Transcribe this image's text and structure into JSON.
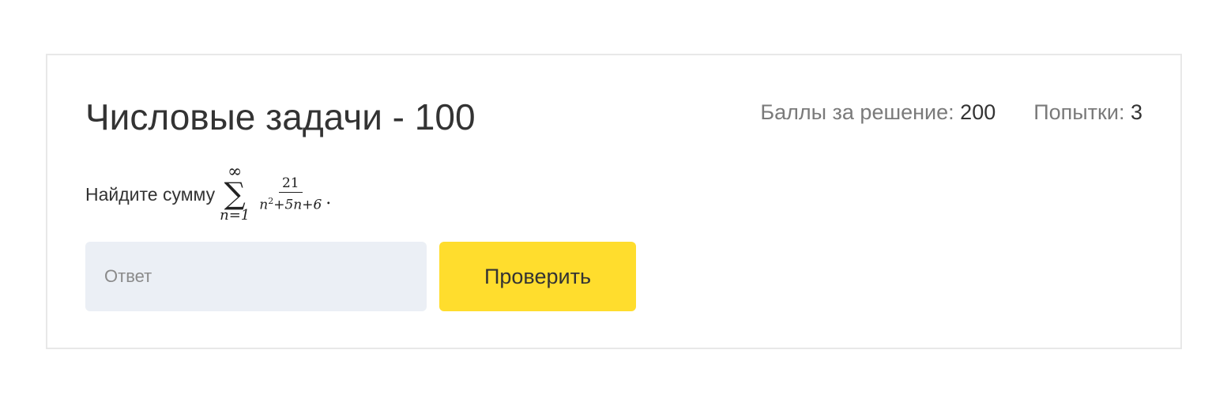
{
  "task": {
    "title": "Числовые задачи - 100",
    "points_label": "Баллы за решение:",
    "points_value": "200",
    "attempts_label": "Попытки:",
    "attempts_value": "3"
  },
  "problem": {
    "text": "Найдите сумму",
    "formula": {
      "sum_upper": "∞",
      "sum_symbol": "∑",
      "sum_lower": "n=1",
      "numerator": "21",
      "denominator_base": "n",
      "denominator_exp": "2",
      "denominator_rest": "+5n+6",
      "period": "."
    }
  },
  "answer": {
    "placeholder": "Ответ",
    "value": ""
  },
  "check_button": {
    "label": "Проверить"
  },
  "colors": {
    "button_accent": "#ffdd2d",
    "input_background": "#ebeff5",
    "card_border": "#e8e8e8"
  }
}
